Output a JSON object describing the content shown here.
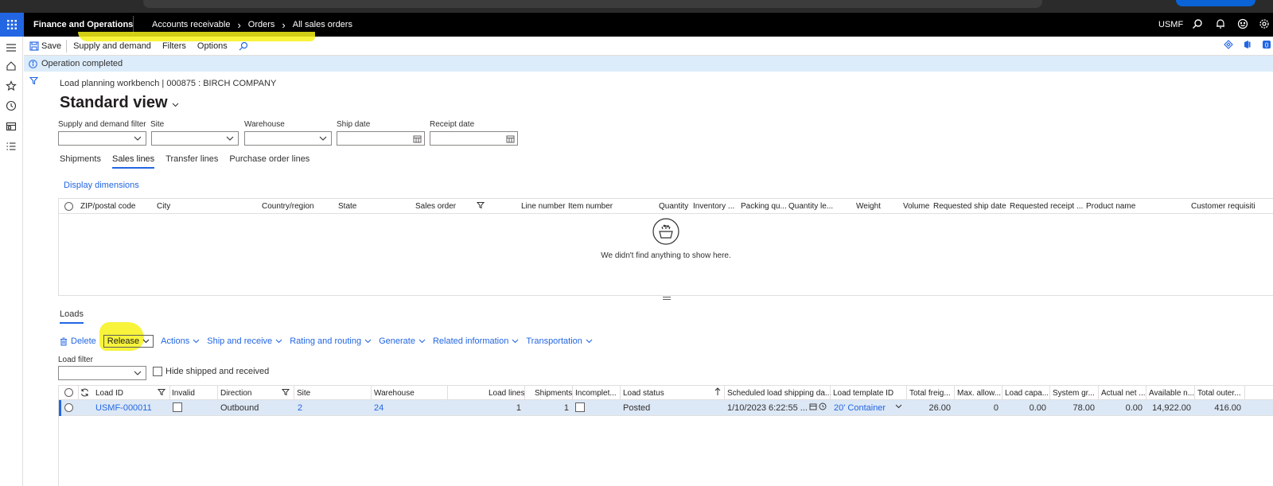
{
  "navbar": {
    "app_name": "Finance and Operations",
    "breadcrumbs": [
      "Accounts receivable",
      "Orders",
      "All sales orders"
    ],
    "company": "USMF"
  },
  "actionpane": {
    "save": "Save",
    "supply_demand": "Supply and demand",
    "filters": "Filters",
    "options": "Options"
  },
  "message": "Operation completed",
  "form": {
    "caption": "Load planning workbench  |  000875 : BIRCH COMPANY",
    "view_title": "Standard view"
  },
  "filters": {
    "supply_demand_label": "Supply and demand filter",
    "site_label": "Site",
    "warehouse_label": "Warehouse",
    "ship_date_label": "Ship date",
    "receipt_date_label": "Receipt date"
  },
  "tabs": [
    "Shipments",
    "Sales lines",
    "Transfer lines",
    "Purchase order lines"
  ],
  "display_dimensions": "Display dimensions",
  "sales_grid": {
    "columns": [
      "ZIP/postal code",
      "City",
      "Country/region",
      "State",
      "Sales order",
      "Line number",
      "Item number",
      "Quantity",
      "Inventory ...",
      "Packing qu...",
      "Quantity le...",
      "Weight",
      "Volume",
      "Requested ship date",
      "Requested receipt ...",
      "Product name",
      "Customer requisiti"
    ],
    "empty_message": "We didn't find anything to show here."
  },
  "loads": {
    "tab_label": "Loads",
    "toolbar": {
      "delete": "Delete",
      "release": "Release",
      "actions": "Actions",
      "ship_receive": "Ship and receive",
      "rating_routing": "Rating and routing",
      "generate": "Generate",
      "related_info": "Related information",
      "transportation": "Transportation"
    },
    "load_filter_label": "Load filter",
    "hide_shipped_label": "Hide shipped and received",
    "columns": [
      "Load ID",
      "Invalid",
      "Direction",
      "Site",
      "Warehouse",
      "Load lines",
      "Shipments",
      "Incomplet...",
      "Load status",
      "Scheduled load shipping da...",
      "Load template ID",
      "Total freig...",
      "Max. allow...",
      "Load capa...",
      "System gr...",
      "Actual net ...",
      "Available n...",
      "Total outer..."
    ],
    "rows": [
      {
        "load_id": "USMF-000011",
        "invalid": false,
        "direction": "Outbound",
        "site": "2",
        "warehouse": "24",
        "load_lines": "1",
        "shipments": "1",
        "incomplete": false,
        "load_status": "Posted",
        "scheduled_ship": "1/10/2023 6:22:55 ...",
        "template_id": "20' Container",
        "total_freight": "26.00",
        "max_allow": "0",
        "load_capacity": "0.00",
        "system_gross": "78.00",
        "actual_net": "0.00",
        "available_net": "14,922.00",
        "total_outer": "416.00"
      }
    ]
  },
  "colors": {
    "accent": "#2266e3",
    "navbar": "#000000",
    "message_bg": "#dcecfa",
    "selected_row": "#dde8f6",
    "highlight": "#f6f219"
  }
}
